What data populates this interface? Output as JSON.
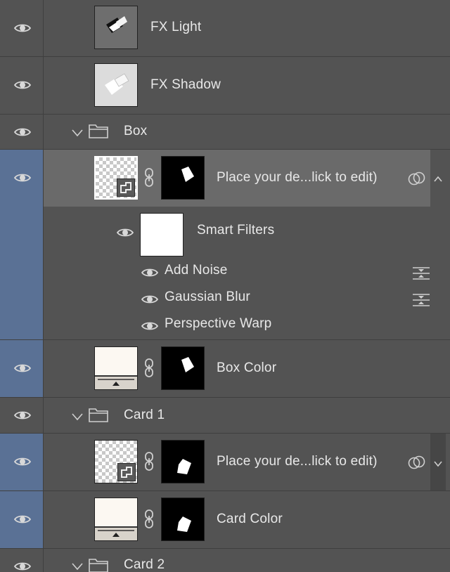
{
  "layers": {
    "fx_light": {
      "name": "FX Light"
    },
    "fx_shadow": {
      "name": "FX Shadow"
    },
    "box_group": {
      "name": "Box"
    },
    "box_smart_object": {
      "name": "Place your de...lick to edit)"
    },
    "smart_filters": {
      "label": "Smart Filters",
      "filters": [
        "Add Noise",
        "Gaussian Blur",
        "Perspective Warp"
      ]
    },
    "box_color": {
      "name": "Box Color"
    },
    "card1_group": {
      "name": "Card 1"
    },
    "card1_smart_object": {
      "name": "Place your de...lick to edit)"
    },
    "card_color": {
      "name": "Card Color"
    },
    "card2_group": {
      "name": "Card 2"
    }
  },
  "colors": {
    "panel_bg": "#535353",
    "selected_eye_column": "#5a7195",
    "selected_row": "#6a6a6a",
    "separator": "#3f3f3f"
  }
}
